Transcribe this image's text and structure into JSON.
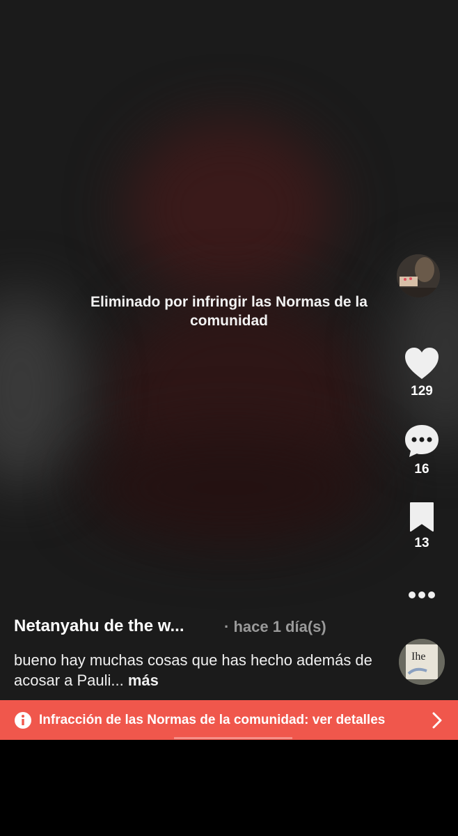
{
  "video": {
    "removed_notice": "Eliminado por infringir las Normas de la comunidad"
  },
  "rail": {
    "likes": "129",
    "comments": "16",
    "saves": "13"
  },
  "post": {
    "author": "Netanyahu de the w...",
    "time": "· hace 1 día(s)",
    "caption": "bueno hay muchas cosas que has hecho además de acosar a Pauli...",
    "more_label": "más"
  },
  "banner": {
    "text": "Infracción de las Normas de la comunidad: ver detalles"
  },
  "colors": {
    "banner": "#f0574c",
    "background": "#1b1b1b"
  }
}
